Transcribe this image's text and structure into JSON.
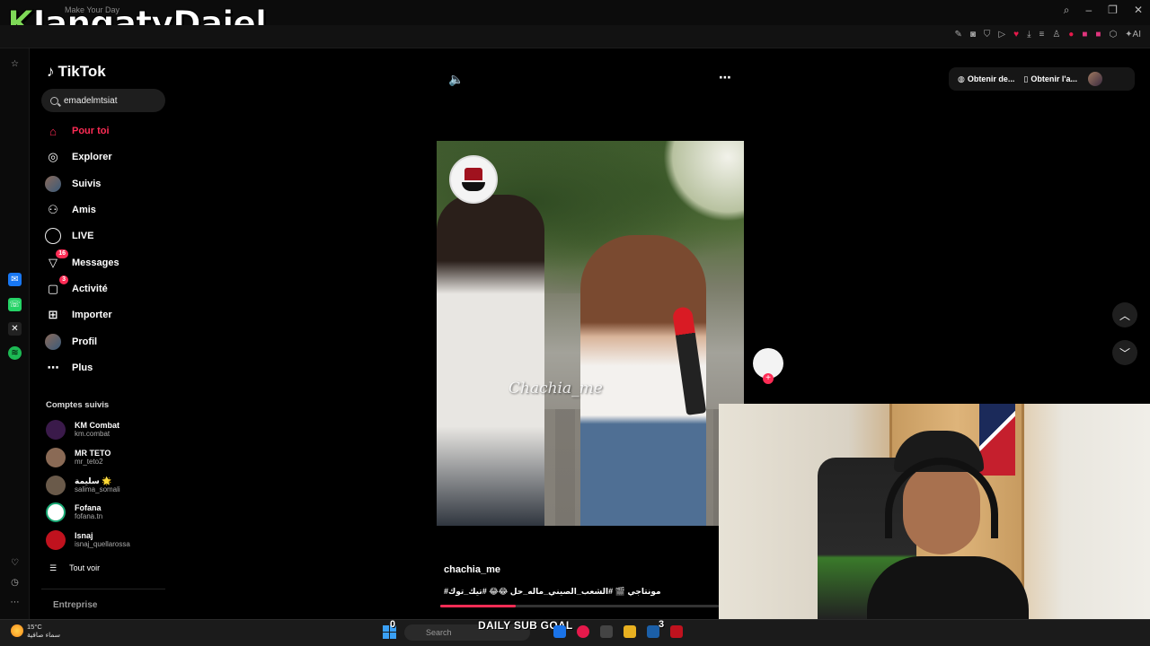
{
  "overlay": {
    "brand_k": "K",
    "brand_rest": "JangatyDajel",
    "tab_title": "Make Your Day"
  },
  "tiktok": {
    "logo": "TikTok",
    "search_value": "emadelmtsiat",
    "nav": [
      {
        "label": "Pour toi"
      },
      {
        "label": "Explorer"
      },
      {
        "label": "Suivis"
      },
      {
        "label": "Amis"
      },
      {
        "label": "LIVE"
      },
      {
        "label": "Messages",
        "badge": "16"
      },
      {
        "label": "Activité",
        "badge": "3"
      },
      {
        "label": "Importer"
      },
      {
        "label": "Profil"
      },
      {
        "label": "Plus"
      }
    ],
    "followed_title": "Comptes suivis",
    "accounts": [
      {
        "name": "KM Combat",
        "handle": "km.combat"
      },
      {
        "name": "MR TETO",
        "handle": "mr_teto2"
      },
      {
        "name": "سليمة 🌟",
        "handle": "salima_somali"
      },
      {
        "name": "Fofana",
        "handle": "fofana.tn"
      },
      {
        "name": "Isnaj",
        "handle": "isnaj_quellarossa"
      }
    ],
    "see_all": "Tout voir",
    "enterprise": "Entreprise",
    "header_buttons": {
      "coins": "Obtenir de...",
      "app": "Obtenir l'a..."
    },
    "video": {
      "watermark": "Chachia_me",
      "username": "chachia_me",
      "hashtags": "#مونتاجي 🎬 #الشعب_الصيني_ماله_حل 😂😂 #تيك_توك",
      "progress": 0.27
    }
  },
  "stream": {
    "goal": "DAILY SUB GOAL",
    "goal_current": "0",
    "goal_target": "3"
  },
  "taskbar": {
    "temp": "15°C",
    "weather": "سماء صافية",
    "search_placeholder": "Search",
    "weather_badge": "4"
  },
  "colors": {
    "accent": "#fe2c55",
    "brand_green": "#7ed957"
  }
}
